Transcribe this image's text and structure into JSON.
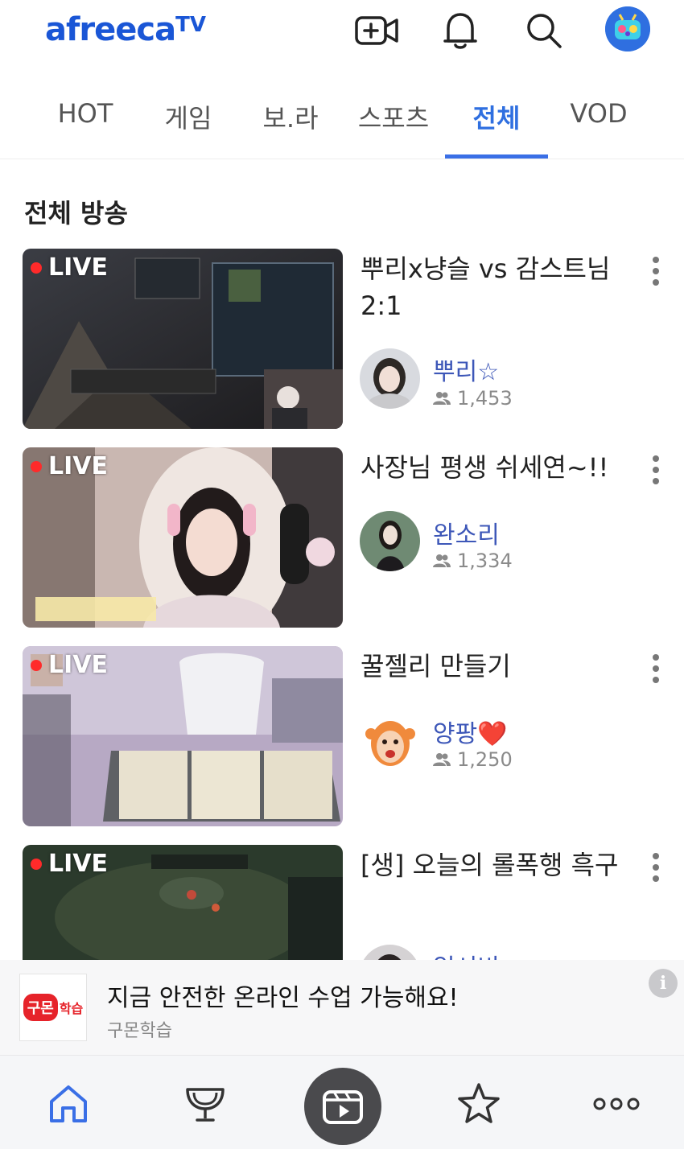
{
  "header": {
    "logo_text": "afreeca",
    "logo_tv": "TV",
    "brand_color": "#1a56d6"
  },
  "tabs": [
    {
      "label": "HOT"
    },
    {
      "label": "게임"
    },
    {
      "label": "보.라"
    },
    {
      "label": "스포츠"
    },
    {
      "label": "전체",
      "active": true
    },
    {
      "label": "VOD"
    }
  ],
  "section": {
    "title": "전체 방송"
  },
  "streams": [
    {
      "live_label": "LIVE",
      "title": "뿌리x냥슬 vs 감스트님 2:1",
      "streamer": "뿌리☆",
      "viewers": "1,453"
    },
    {
      "live_label": "LIVE",
      "title": "사장님 평생 쉬세연~!!",
      "streamer": "완소리",
      "viewers": "1,334"
    },
    {
      "live_label": "LIVE",
      "title": "꿀젤리 만들기",
      "streamer": "양팡",
      "streamer_emoji": "❤️",
      "viewers": "1,250"
    },
    {
      "live_label": "LIVE",
      "title": "[생] 오늘의 롤폭행 흑구",
      "streamer": "입서비",
      "viewers": ""
    }
  ],
  "ad": {
    "logo_text": "구몬",
    "logo_sub": "학습",
    "title": "지금 안전한 온라인 수업 가능해요!",
    "advertiser": "구몬학습",
    "info_label": "i"
  },
  "bottom_nav": [
    {
      "icon": "home-icon"
    },
    {
      "icon": "trophy-icon"
    },
    {
      "icon": "video-play-icon"
    },
    {
      "icon": "star-icon"
    },
    {
      "icon": "more-icon"
    }
  ],
  "colors": {
    "accent": "#2f6fe0",
    "streamer_name": "#3d57b8",
    "live_dot": "#ff2a2a"
  }
}
